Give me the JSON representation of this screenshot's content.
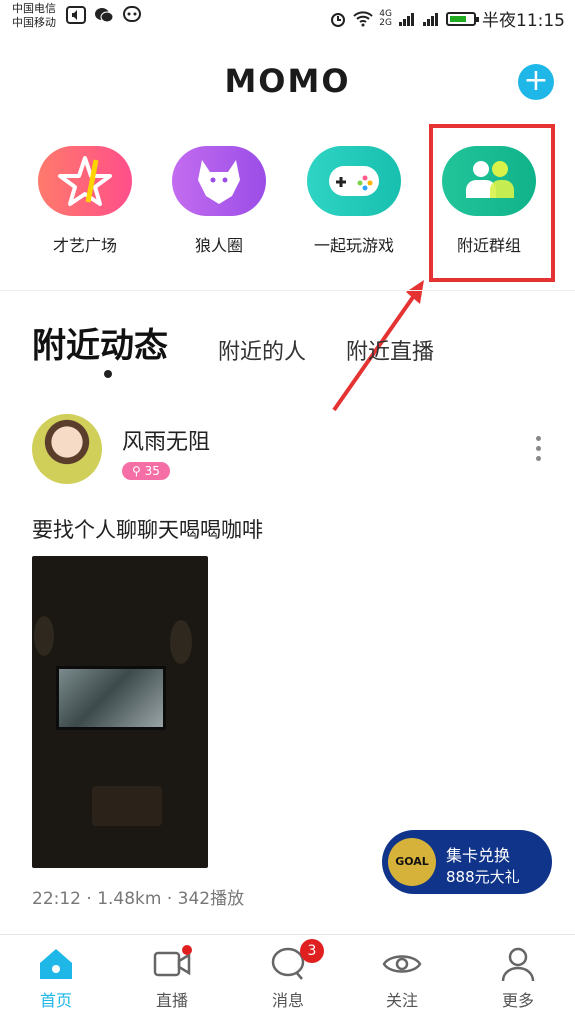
{
  "status_bar": {
    "carrier1": "中国电信",
    "carrier2": "中国移动",
    "network1": "4G",
    "network2": "2G",
    "time": "半夜11:15"
  },
  "header": {
    "logo": "MOMO"
  },
  "shortcuts": [
    {
      "label": "才艺广场",
      "icon": "star-icon"
    },
    {
      "label": "狼人圈",
      "icon": "wolf-icon"
    },
    {
      "label": "一起玩游戏",
      "icon": "gamepad-icon"
    },
    {
      "label": "附近群组",
      "icon": "group-icon"
    }
  ],
  "tabs": {
    "active": "附近动态",
    "tab2": "附近的人",
    "tab3": "附近直播"
  },
  "post": {
    "username": "风雨无阻",
    "badge": "35",
    "text": "要找个人聊聊天喝喝咖啡",
    "meta": "22:12 · 1.48km · 342播放"
  },
  "promo": {
    "title": "集卡兑换",
    "subtitle": "888元大礼",
    "ball_text": "GOAL"
  },
  "bottom_nav": [
    {
      "label": "首页"
    },
    {
      "label": "直播"
    },
    {
      "label": "消息",
      "badge": "3"
    },
    {
      "label": "关注"
    },
    {
      "label": "更多"
    }
  ],
  "colors": {
    "accent": "#1fb6e8",
    "highlight": "#e53333",
    "badge_red": "#e02020"
  }
}
